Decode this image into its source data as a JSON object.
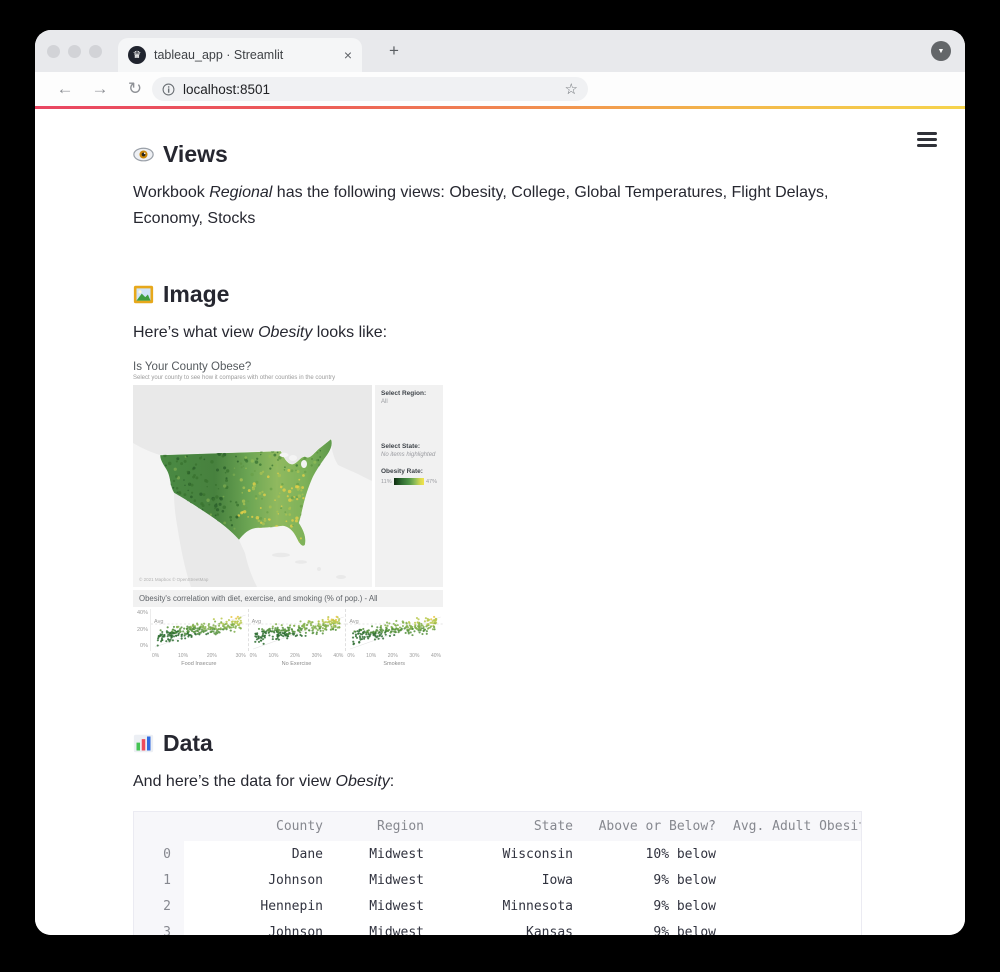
{
  "browser": {
    "tab_title": "tableau_app · Streamlit",
    "tab_close": "×",
    "new_tab": "+",
    "url": "localhost:8501",
    "back": "←",
    "forward": "→",
    "reload": "↻",
    "star": "☆",
    "menu_arrow": "▼",
    "favicon_glyph": "♛",
    "decoration_colors": [
      "#e94662",
      "#f1904f",
      "#f6d44c"
    ]
  },
  "views_section": {
    "heading": "Views",
    "text_prefix": "Workbook ",
    "workbook_name": "Regional",
    "text_suffix": " has the following views: Obesity, College, Global Temperatures, Flight Delays, Economy, Stocks"
  },
  "image_section": {
    "heading": "Image",
    "text_prefix": "Here’s what view ",
    "view_name": "Obesity",
    "text_suffix": " looks like:"
  },
  "data_section": {
    "heading": "Data",
    "text_prefix": "And here’s the data for view ",
    "view_name": "Obesity",
    "text_suffix": ":"
  },
  "viz": {
    "title": "Is Your County Obese?",
    "subtitle": "Select your county to see how it compares with other counties in the country",
    "attribution": "© 2021 Mapbox © OpenStreetMap",
    "sidebar": {
      "region_label": "Select Region:",
      "region_value": "All",
      "state_label": "Select State:",
      "state_value": "No items highlighted",
      "rate_label": "Obesity Rate:",
      "legend_min": "11%",
      "legend_max": "47%",
      "legend_colors": [
        "#0f2d10",
        "#4f9447",
        "#f2e34d"
      ]
    },
    "scatter": {
      "title": "Obesity's correlation with diet, exercise, and smoking (% of pop.) - All",
      "avg_label": "Avg",
      "y_ticks": [
        "40%",
        "20%",
        "0%"
      ],
      "panels": [
        {
          "label": "Food Insecure",
          "x_ticks": [
            "0%",
            "10%",
            "20%",
            "30%"
          ]
        },
        {
          "label": "No Exercise",
          "x_ticks": [
            "0%",
            "10%",
            "20%",
            "30%",
            "40%"
          ]
        },
        {
          "label": "Smokers",
          "x_ticks": [
            "0%",
            "10%",
            "20%",
            "30%",
            "40%"
          ]
        }
      ]
    }
  },
  "table": {
    "headers": [
      "County",
      "Region",
      "State",
      "Above or Below?",
      "Avg. Adult Obesity"
    ],
    "rows": [
      [
        "0",
        "Dane",
        "Midwest",
        "Wisconsin",
        "10% below"
      ],
      [
        "1",
        "Johnson",
        "Midwest",
        "Iowa",
        "9% below"
      ],
      [
        "2",
        "Hennepin",
        "Midwest",
        "Minnesota",
        "9% below"
      ],
      [
        "3",
        "Johnson",
        "Midwest",
        "Kansas",
        "9% below"
      ]
    ]
  }
}
